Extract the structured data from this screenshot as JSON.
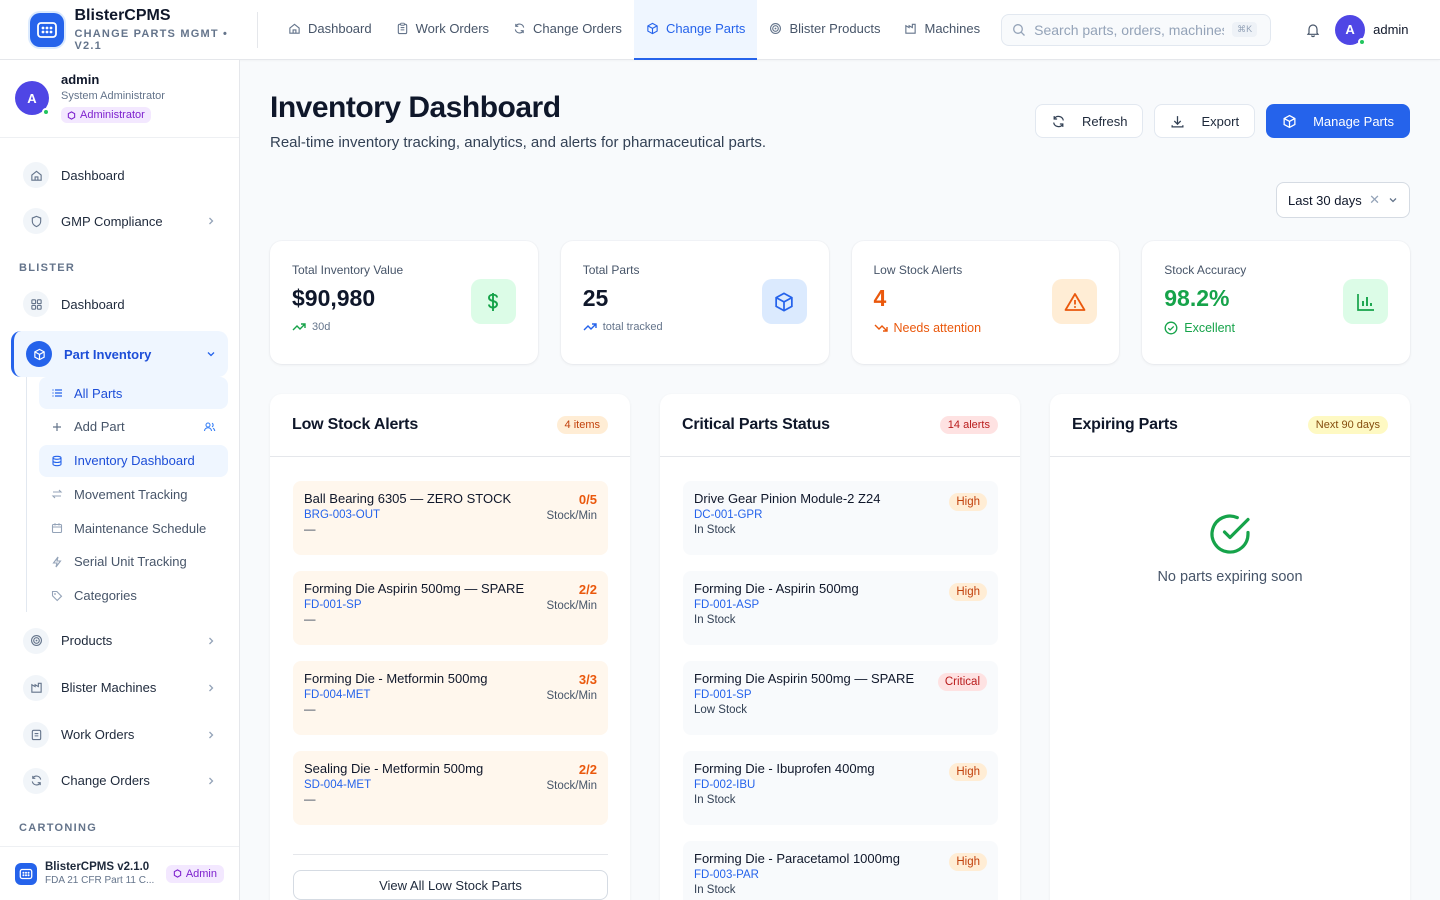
{
  "brand": {
    "name": "BlisterCPMS",
    "subtitle": "CHANGE PARTS MGMT • V2.1"
  },
  "topnav": [
    {
      "label": "Dashboard",
      "icon": "home-icon"
    },
    {
      "label": "Work Orders",
      "icon": "clipboard-icon"
    },
    {
      "label": "Change Orders",
      "icon": "refresh-icon"
    },
    {
      "label": "Change Parts",
      "icon": "box-icon",
      "active": true
    },
    {
      "label": "Blister Products",
      "icon": "target-icon"
    },
    {
      "label": "Machines",
      "icon": "building-icon"
    }
  ],
  "search": {
    "placeholder": "Search parts, orders, machines...",
    "shortcut": "⌘K"
  },
  "user": {
    "initial": "A",
    "name": "admin",
    "role": "System Administrator",
    "badge": "Administrator"
  },
  "sidebar": {
    "items_top": [
      {
        "label": "Dashboard",
        "icon": "home-icon"
      },
      {
        "label": "GMP Compliance",
        "icon": "shield-icon"
      }
    ],
    "section_blister": "BLISTER",
    "blister_dashboard": "Dashboard",
    "part_inventory": "Part Inventory",
    "sub_items": [
      {
        "label": "All Parts",
        "icon": "list-icon"
      },
      {
        "label": "Add Part",
        "icon": "plus-icon"
      },
      {
        "label": "Inventory Dashboard",
        "icon": "database-icon"
      },
      {
        "label": "Movement Tracking",
        "icon": "arrows-icon"
      },
      {
        "label": "Maintenance Schedule",
        "icon": "calendar-icon"
      },
      {
        "label": "Serial Unit Tracking",
        "icon": "bolt-icon"
      },
      {
        "label": "Categories",
        "icon": "tag-icon"
      }
    ],
    "items_bottom": [
      {
        "label": "Products",
        "icon": "target-icon"
      },
      {
        "label": "Blister Machines",
        "icon": "building-icon"
      },
      {
        "label": "Work Orders",
        "icon": "clipboard-icon"
      },
      {
        "label": "Change Orders",
        "icon": "refresh-icon"
      }
    ],
    "section_cartoning": "CARTONING",
    "footer": {
      "title": "BlisterCPMS v2.1.0",
      "subtitle": "FDA 21 CFR Part 11 C...",
      "badge": "Admin"
    }
  },
  "page": {
    "title": "Inventory Dashboard",
    "subtitle": "Real-time inventory tracking, analytics, and alerts for pharmaceutical parts.",
    "actions": {
      "refresh": "Refresh",
      "export": "Export",
      "manage": "Manage Parts"
    },
    "period": "Last 30 days"
  },
  "stats": [
    {
      "label": "Total Inventory Value",
      "value": "$90,980",
      "meta": "30d",
      "icon": "dollar-icon",
      "value_color": "#0f172a"
    },
    {
      "label": "Total Parts",
      "value": "25",
      "meta": "total tracked",
      "icon": "box-icon",
      "value_color": "#0f172a"
    },
    {
      "label": "Low Stock Alerts",
      "value": "4",
      "meta": "Needs attention",
      "icon": "warning-icon",
      "value_color": "#ea580c"
    },
    {
      "label": "Stock Accuracy",
      "value": "98.2%",
      "meta": "Excellent",
      "icon": "bar-chart-icon",
      "value_color": "#16a34a"
    }
  ],
  "low_stock": {
    "title": "Low Stock Alerts",
    "count": "4 items",
    "items": [
      {
        "name": "Ball Bearing 6305 — ZERO STOCK",
        "code": "BRG-003-OUT",
        "note": "—",
        "ratio": "0/5",
        "unit": "Stock/Min"
      },
      {
        "name": "Forming Die Aspirin 500mg — SPARE",
        "code": "FD-001-SP",
        "note": "—",
        "ratio": "2/2",
        "unit": "Stock/Min"
      },
      {
        "name": "Forming Die - Metformin 500mg",
        "code": "FD-004-MET",
        "note": "—",
        "ratio": "3/3",
        "unit": "Stock/Min"
      },
      {
        "name": "Sealing Die - Metformin 500mg",
        "code": "SD-004-MET",
        "note": "—",
        "ratio": "2/2",
        "unit": "Stock/Min"
      }
    ],
    "view_all": "View All Low Stock Parts"
  },
  "critical": {
    "title": "Critical Parts Status",
    "count": "14 alerts",
    "items": [
      {
        "name": "Drive Gear Pinion Module-2 Z24",
        "code": "DC-001-GPR",
        "status": "In Stock",
        "priority": "High"
      },
      {
        "name": "Forming Die - Aspirin 500mg",
        "code": "FD-001-ASP",
        "status": "In Stock",
        "priority": "High"
      },
      {
        "name": "Forming Die Aspirin 500mg — SPARE",
        "code": "FD-001-SP",
        "status": "Low Stock",
        "priority": "Critical"
      },
      {
        "name": "Forming Die - Ibuprofen 400mg",
        "code": "FD-002-IBU",
        "status": "In Stock",
        "priority": "High"
      },
      {
        "name": "Forming Die - Paracetamol 1000mg",
        "code": "FD-003-PAR",
        "status": "In Stock",
        "priority": "High"
      }
    ]
  },
  "expiring": {
    "title": "Expiring Parts",
    "badge": "Next 90 days",
    "empty": "No parts expiring soon"
  }
}
